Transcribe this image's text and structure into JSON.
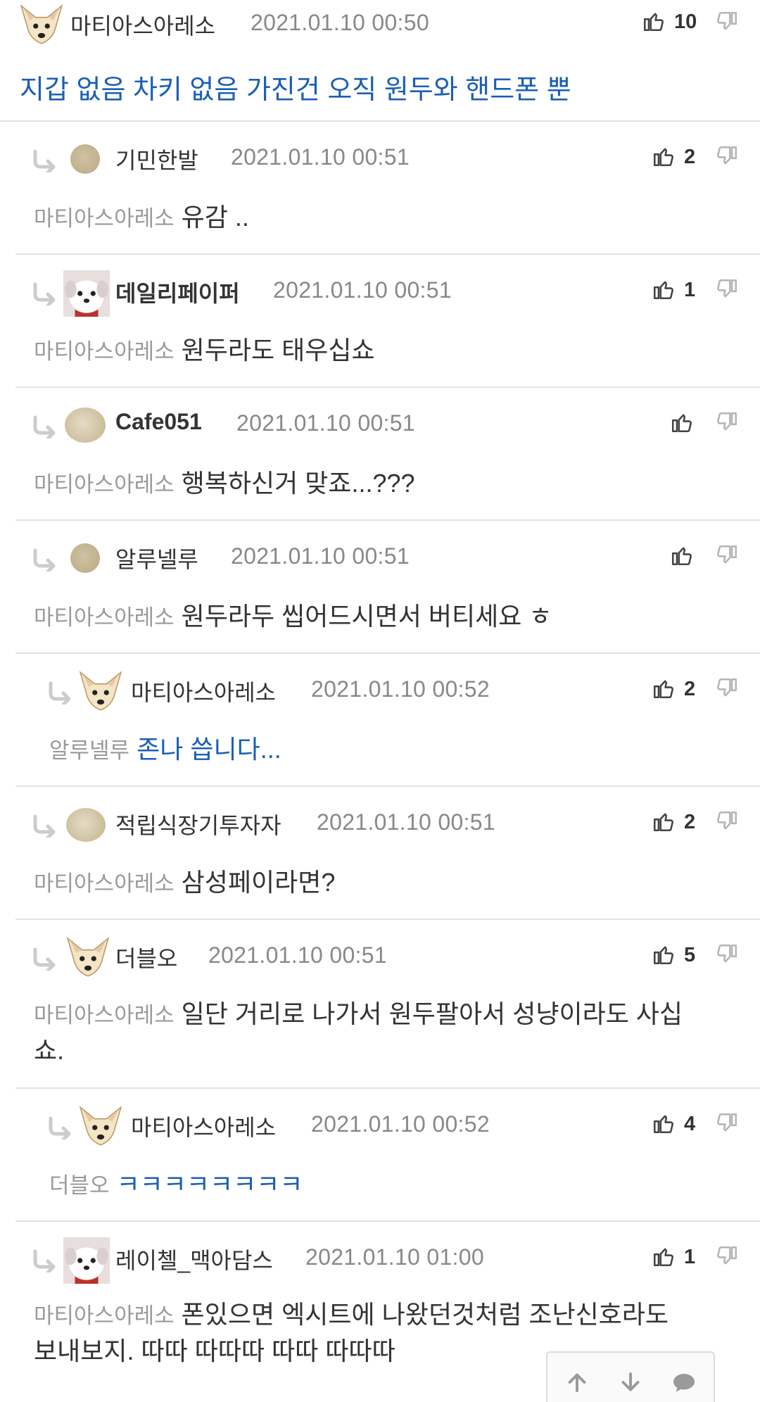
{
  "comments": [
    {
      "author": "마티아스아레소",
      "timestamp": "2021.01.10 00:50",
      "likes": "10",
      "text": "지갑 없음 차키 없음 가진건 오직 원두와 핸드폰 뿐",
      "avatar": "chihuahua-icon"
    },
    {
      "author": "기민한발",
      "timestamp": "2021.01.10 00:51",
      "likes": "2",
      "mention": "마티아스아레소",
      "text": "유감 ..",
      "avatar": "tan-circle-avatar"
    },
    {
      "author": "데일리페이퍼",
      "timestamp": "2021.01.10 00:51",
      "likes": "1",
      "mention": "마티아스아레소",
      "text": "원두라도 태우십쇼",
      "avatar": "dog-avatar"
    },
    {
      "author": "Cafe051",
      "timestamp": "2021.01.10 00:51",
      "likes": "",
      "mention": "마티아스아레소",
      "text": "행복하신거 맞죠...???",
      "avatar": "blob-avatar"
    },
    {
      "author": "알루넬루",
      "timestamp": "2021.01.10 00:51",
      "likes": "",
      "mention": "마티아스아레소",
      "text": "원두라두 씹어드시면서 버티세요 ㅎ",
      "avatar": "tan-circle-avatar"
    },
    {
      "author": "마티아스아레소",
      "timestamp": "2021.01.10 00:52",
      "likes": "2",
      "mention": "알루넬루",
      "text": "존나 씁니다...",
      "avatar": "chihuahua-icon"
    },
    {
      "author": "적립식장기투자자",
      "timestamp": "2021.01.10 00:51",
      "likes": "2",
      "mention": "마티아스아레소",
      "text": "삼성페이라면?",
      "avatar": "blob-avatar"
    },
    {
      "author": "더블오",
      "timestamp": "2021.01.10 00:51",
      "likes": "5",
      "mention": "마티아스아레소",
      "text_line1": "일단 거리로 나가서 원두팔아서 성냥이라도 사십",
      "text_line2": "쇼.",
      "avatar": "chihuahua-icon"
    },
    {
      "author": "마티아스아레소",
      "timestamp": "2021.01.10 00:52",
      "likes": "4",
      "mention": "더블오",
      "text": "ㅋㅋㅋㅋㅋㅋㅋㅋ",
      "avatar": "chihuahua-icon"
    },
    {
      "author": "레이첼_맥아담스",
      "timestamp": "2021.01.10 01:00",
      "likes": "1",
      "mention": "마티아스아레소",
      "text_line1": "폰있으면 엑시트에 나왔던것처럼 조난신호라도",
      "text_line2": "보내보지. 따따 따따따 따따 따따따",
      "avatar": "dog-avatar"
    }
  ],
  "nav": {
    "up_icon": "arrow-up-icon",
    "down_icon": "arrow-down-icon",
    "comment_icon": "comment-icon"
  },
  "colors": {
    "link_blue": "#1a5fb4",
    "meta_gray": "#888888",
    "divider": "#e2e2e2"
  }
}
